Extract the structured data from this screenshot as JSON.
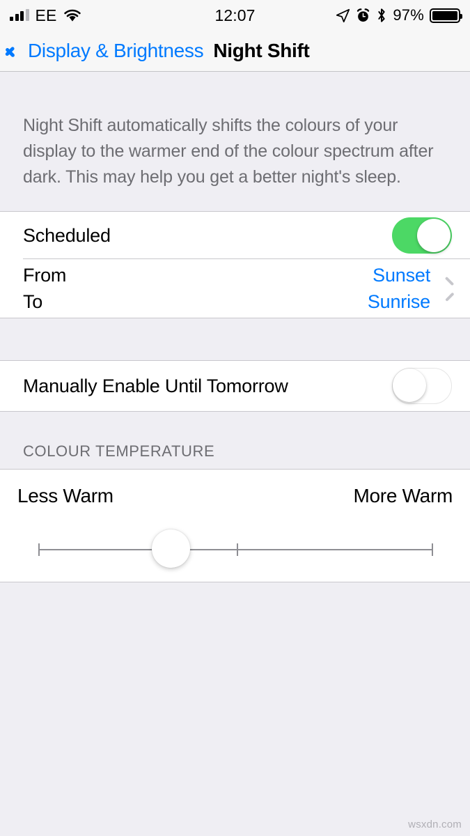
{
  "status_bar": {
    "carrier": "EE",
    "time": "12:07",
    "battery_percent": "97%",
    "signal_bars_filled": 3,
    "signal_bars_total": 4,
    "icons": [
      "signal-icon",
      "wifi-icon",
      "location-arrow-icon",
      "alarm-clock-icon",
      "bluetooth-icon",
      "battery-icon"
    ]
  },
  "nav": {
    "back_label": "Display & Brightness",
    "title": "Night Shift"
  },
  "description": "Night Shift automatically shifts the colours of your display to the warmer end of the colour spectrum after dark. This may help you get a better night's sleep.",
  "scheduled": {
    "label": "Scheduled",
    "toggle_state": "on"
  },
  "schedule_times": {
    "from_label": "From",
    "to_label": "To",
    "from_value": "Sunset",
    "to_value": "Sunrise"
  },
  "manual": {
    "label": "Manually Enable Until Tomorrow",
    "toggle_state": "off"
  },
  "colour_temperature": {
    "header": "COLOUR TEMPERATURE",
    "min_label": "Less Warm",
    "max_label": "More Warm",
    "value_percent": 33.5
  },
  "watermark": "wsxdn.com",
  "colors": {
    "accent_blue": "#007AFF",
    "toggle_on_green": "#4CD865",
    "background_gray": "#EFEEF3",
    "card_white": "#FFFFFF",
    "separator": "#C8C7CC",
    "secondary_text": "#6D6D72"
  }
}
